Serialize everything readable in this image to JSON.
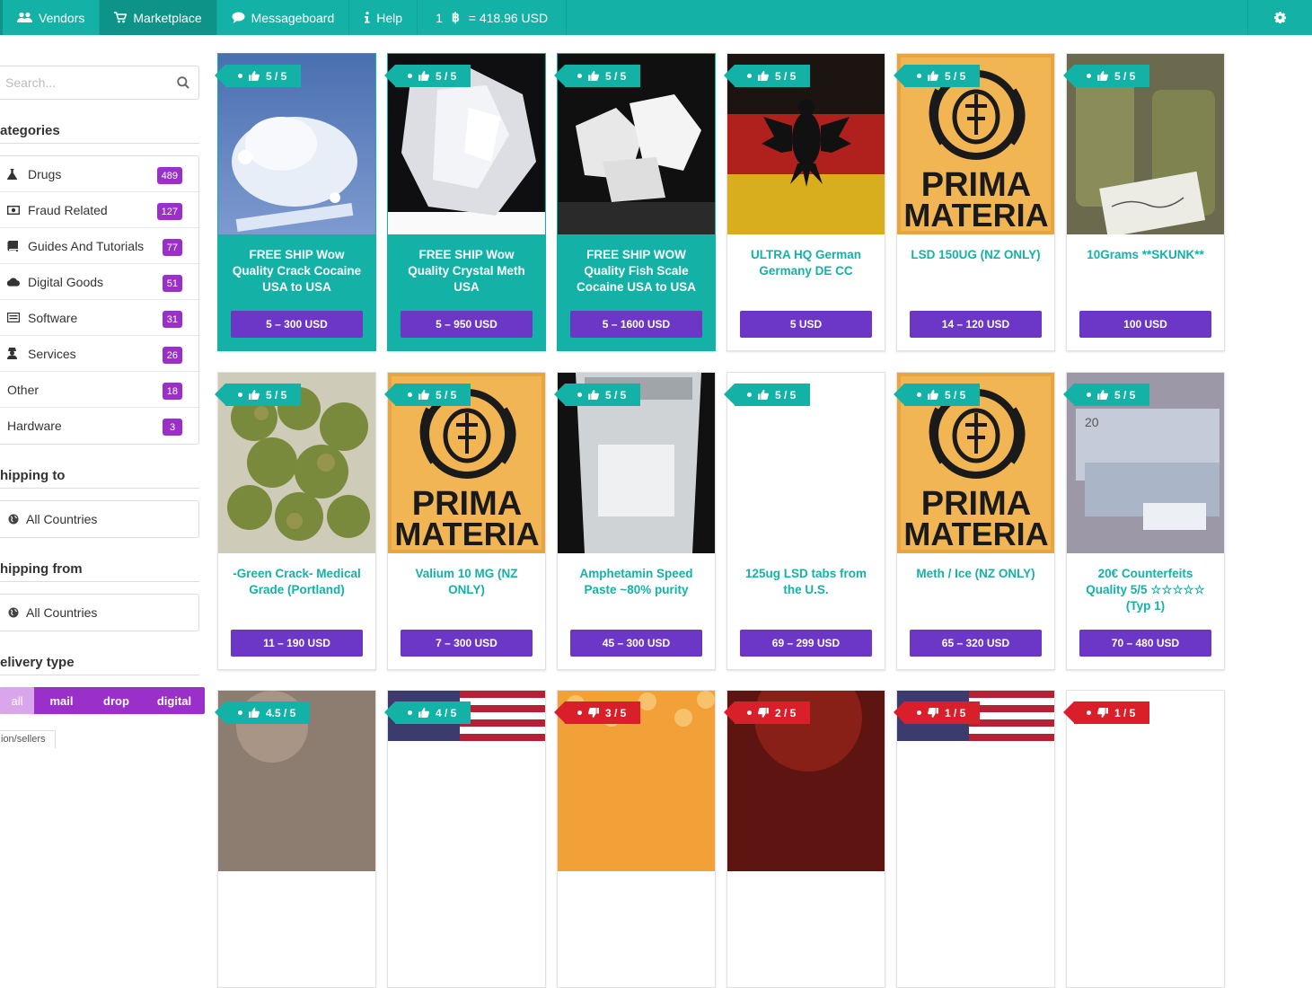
{
  "nav": {
    "vendors": "Vendors",
    "marketplace": "Marketplace",
    "messageboard": "Messageboard",
    "help": "Help",
    "rate_amount": "1",
    "rate_symbol": "฿",
    "rate_value": "= 418.96 USD"
  },
  "sidebar": {
    "search_placeholder": "Search...",
    "categories_title": "ategories",
    "categories": [
      {
        "label": "Drugs",
        "count": "489",
        "icon": "flask-icon"
      },
      {
        "label": "Fraud Related",
        "count": "127",
        "icon": "money-icon"
      },
      {
        "label": "Guides And Tutorials",
        "count": "77",
        "icon": "book-icon"
      },
      {
        "label": "Digital Goods",
        "count": "51",
        "icon": "cloud-icon"
      },
      {
        "label": "Software",
        "count": "31",
        "icon": "list-icon"
      },
      {
        "label": "Services",
        "count": "26",
        "icon": "user-secret-icon"
      },
      {
        "label": "Other",
        "count": "18",
        "icon": ""
      },
      {
        "label": "Hardware",
        "count": "3",
        "icon": ""
      }
    ],
    "shipping_to_title": "hipping to",
    "shipping_to_value": "All Countries",
    "shipping_from_title": "hipping from",
    "shipping_from_value": "All Countries",
    "delivery_title": "elivery type",
    "delivery_options": [
      "all",
      "mail",
      "drop",
      "digital"
    ],
    "cut_tab": "ion/sellers"
  },
  "products": [
    {
      "title": "FREE SHIP Wow Quality Crack Cocaine USA to USA",
      "price": "5 – 300 USD",
      "rating": "5 / 5",
      "style": "teal",
      "image": "white-powder"
    },
    {
      "title": "FREE SHIP Wow Quality Crystal Meth USA",
      "price": "5 – 950 USD",
      "rating": "5 / 5",
      "style": "teal",
      "image": "crystal"
    },
    {
      "title": "FREE SHIP WOW Quality Fish Scale Cocaine USA to USA",
      "price": "5 – 1600 USD",
      "rating": "5 / 5",
      "style": "teal",
      "image": "rocks"
    },
    {
      "title": "ULTRA HQ German Germany DE CC",
      "price": "5 USD",
      "rating": "5 / 5",
      "style": "plain",
      "image": "german-flag"
    },
    {
      "title": "LSD 150UG (NZ ONLY)",
      "price": "14 – 120 USD",
      "rating": "5 / 5",
      "style": "plain",
      "image": "prima-materia"
    },
    {
      "title": "10Grams **SKUNK**",
      "price": "100 USD",
      "rating": "5 / 5",
      "style": "plain",
      "image": "jars"
    },
    {
      "title": "-Green Crack- Medical Grade (Portland)",
      "price": "11 – 190 USD",
      "rating": "5 / 5",
      "style": "plain",
      "image": "buds"
    },
    {
      "title": "Valium 10 MG (NZ ONLY)",
      "price": "7 – 300 USD",
      "rating": "5 / 5",
      "style": "plain",
      "image": "prima-materia"
    },
    {
      "title": "Amphetamin Speed Paste ~80% purity",
      "price": "45 – 300 USD",
      "rating": "5 / 5",
      "style": "plain",
      "image": "bag"
    },
    {
      "title": "125ug LSD tabs from the U.S.",
      "price": "69 – 299 USD",
      "rating": "5 / 5",
      "style": "plain",
      "image": "blank"
    },
    {
      "title": "Meth / Ice (NZ ONLY)",
      "price": "65 – 320 USD",
      "rating": "5 / 5",
      "style": "plain",
      "image": "prima-materia"
    },
    {
      "title": "20€ Counterfeits Quality 5/5 ☆☆☆☆☆ (Typ 1)",
      "price": "70 – 480 USD",
      "rating": "5 / 5",
      "style": "plain",
      "image": "banknotes"
    },
    {
      "title": "",
      "price": "",
      "rating": "4.5 / 5",
      "style": "plain",
      "image": "dark-photo"
    },
    {
      "title": "",
      "price": "",
      "rating": "4 / 5",
      "style": "plain",
      "image": "us-flag"
    },
    {
      "title": "",
      "price": "",
      "rating": "3 / 5",
      "style": "plain",
      "image": "bitcoin-pattern",
      "bad": true
    },
    {
      "title": "",
      "price": "",
      "rating": "2 / 5",
      "style": "plain",
      "image": "red-dark",
      "bad": true
    },
    {
      "title": "",
      "price": "",
      "rating": "1 / 5",
      "style": "plain",
      "image": "us-flag",
      "bad": true
    },
    {
      "title": "",
      "price": "",
      "rating": "1 / 5",
      "style": "plain",
      "image": "blank",
      "bad": true
    }
  ],
  "colors": {
    "teal": "#14b2a6",
    "purple_price": "#6c36c7",
    "badge_purple": "#9b2fc9",
    "bad_red": "#d9202a"
  }
}
